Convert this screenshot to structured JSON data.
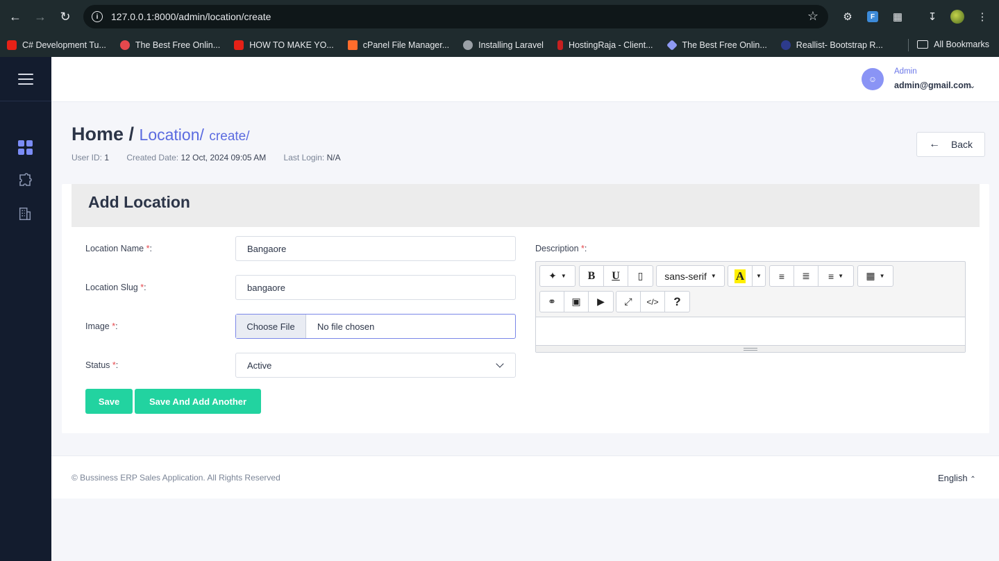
{
  "browser": {
    "url": "127.0.0.1:8000/admin/location/create",
    "bookmarks": [
      "C# Development Tu...",
      "The Best Free Onlin...",
      "HOW TO MAKE YO...",
      "cPanel File Manager...",
      "Installing Laravel",
      "HostingRaja - Client...",
      "The Best Free Onlin...",
      "Reallist- Bootstrap R..."
    ],
    "all_bookmarks": "All Bookmarks",
    "ext_badge": "F"
  },
  "header": {
    "user_role": "Admin",
    "user_email": "admin@gmail.com"
  },
  "page": {
    "title": "Home /",
    "crumb": "Location/",
    "crumb_sub": "create/",
    "meta": {
      "user_id_label": "User ID:",
      "user_id": "1",
      "created_label": "Created Date:",
      "created": "12 Oct, 2024 09:05 AM",
      "login_label": "Last Login:",
      "login": "N/A"
    },
    "back_label": "Back"
  },
  "form": {
    "title": "Add Location",
    "required_mark": "*",
    "location_name_label": "Location Name",
    "location_name_value": "Bangaore",
    "location_slug_label": "Location Slug",
    "location_slug_value": "bangaore",
    "image_label": "Image",
    "choose_file": "Choose File",
    "no_file": "No file chosen",
    "status_label": "Status",
    "status_value": "Active",
    "description_label": "Description",
    "font_name": "sans-serif",
    "save": "Save",
    "save_add": "Save And Add Another"
  },
  "footer": {
    "copyright": "© Bussiness ERP Sales Application. All Rights Reserved",
    "language": "English"
  }
}
